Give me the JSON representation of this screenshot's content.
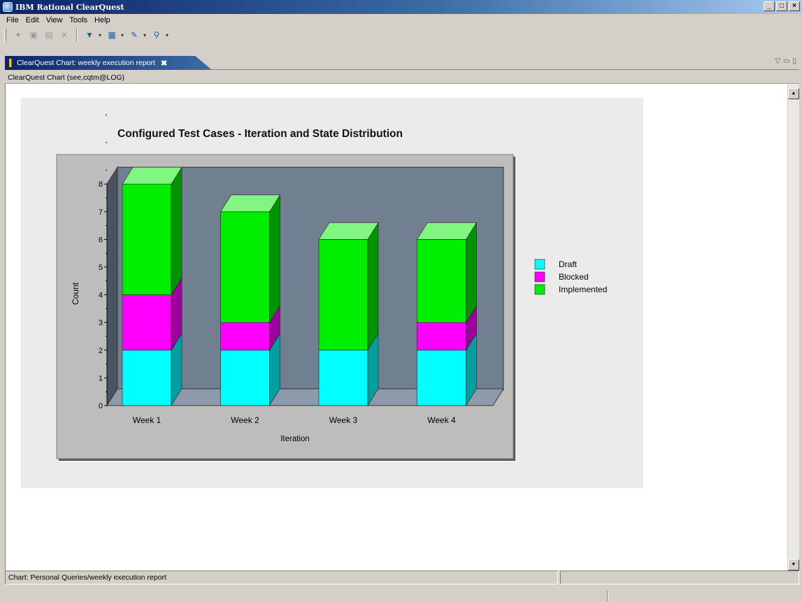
{
  "window": {
    "title": "IBM Rational ClearQuest",
    "buttons": [
      "_",
      "□",
      "×"
    ]
  },
  "menu": [
    "File",
    "Edit",
    "View",
    "Tools",
    "Help"
  ],
  "editor_tab": {
    "label": "ClearQuest Chart: weekly execution report",
    "close": "✖"
  },
  "header_line": "ClearQuest Chart (see,cqtm@LOG)",
  "status": {
    "left": "Chart: Personal Queries/weekly execution report",
    "right": ""
  },
  "colors": {
    "draft": "#00ffff",
    "blocked": "#ff00ff",
    "implemented": "#00ee00",
    "plot_back": "#708090",
    "chart_frame": "#bdbdbd"
  },
  "chart_data": {
    "type": "bar",
    "stacked": true,
    "three_d": true,
    "title": "Configured Test Cases - Iteration and State Distribution",
    "xlabel": "Iteration",
    "ylabel": "Count",
    "categories": [
      "Week 1",
      "Week 2",
      "Week 3",
      "Week 4"
    ],
    "ylim": [
      0,
      8
    ],
    "yticks": [
      "0",
      "1",
      "2",
      "3",
      "4",
      "5",
      "6",
      "7",
      "8"
    ],
    "series": [
      {
        "name": "Draft",
        "values": [
          2,
          2,
          2,
          2
        ]
      },
      {
        "name": "Blocked",
        "values": [
          2,
          1,
          0,
          1
        ]
      },
      {
        "name": "Implemented",
        "values": [
          4,
          4,
          4,
          3
        ]
      }
    ],
    "legend_position": "right",
    "grid": false
  }
}
